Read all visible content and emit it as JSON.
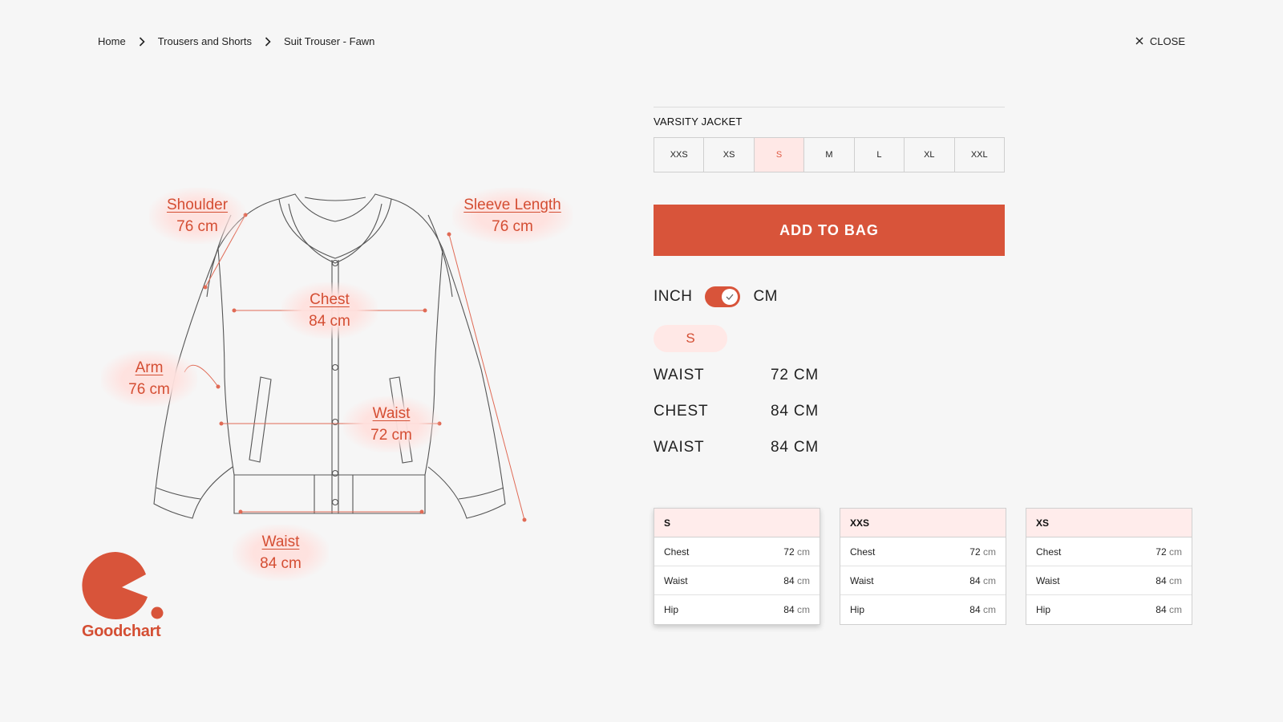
{
  "breadcrumb": {
    "items": [
      "Home",
      "Trousers and Shorts",
      "Suit Trouser - Fawn"
    ]
  },
  "close_label": "CLOSE",
  "callouts": {
    "shoulder": {
      "label": "Shoulder",
      "value": "76 cm"
    },
    "sleeve": {
      "label": "Sleeve Length",
      "value": "76 cm"
    },
    "chest": {
      "label": "Chest",
      "value": "84 cm"
    },
    "arm": {
      "label": "Arm",
      "value": "76 cm"
    },
    "waist": {
      "label": "Waist",
      "value": "72 cm"
    },
    "hem": {
      "label": "Waist",
      "value": "84 cm"
    }
  },
  "brand": {
    "name": "Goodchart",
    "color": "#d8543a"
  },
  "product": {
    "name": "VARSITY JACKET"
  },
  "sizes": [
    "XXS",
    "XS",
    "S",
    "M",
    "L",
    "XL",
    "XXL"
  ],
  "selected_size": "S",
  "add_to_bag": "ADD TO BAG",
  "units": {
    "left": "INCH",
    "right": "CM",
    "selected": "CM"
  },
  "measurements": [
    {
      "label": "WAIST",
      "value": "72 CM"
    },
    {
      "label": "CHEST",
      "value": "84 CM"
    },
    {
      "label": "WAIST",
      "value": "84 CM"
    }
  ],
  "cards": [
    {
      "size": "S",
      "rows": [
        {
          "label": "Chest",
          "value": "72",
          "unit": "cm"
        },
        {
          "label": "Waist",
          "value": "84",
          "unit": "cm"
        },
        {
          "label": "Hip",
          "value": "84",
          "unit": "cm"
        }
      ]
    },
    {
      "size": "XXS",
      "rows": [
        {
          "label": "Chest",
          "value": "72",
          "unit": "cm"
        },
        {
          "label": "Waist",
          "value": "84",
          "unit": "cm"
        },
        {
          "label": "Hip",
          "value": "84",
          "unit": "cm"
        }
      ]
    },
    {
      "size": "XS",
      "rows": [
        {
          "label": "Chest",
          "value": "72",
          "unit": "cm"
        },
        {
          "label": "Waist",
          "value": "84",
          "unit": "cm"
        },
        {
          "label": "Hip",
          "value": "84",
          "unit": "cm"
        }
      ]
    }
  ],
  "colors": {
    "accent": "#d8543a",
    "accent_soft": "#ffe8e6",
    "background": "#f6f6f6"
  }
}
